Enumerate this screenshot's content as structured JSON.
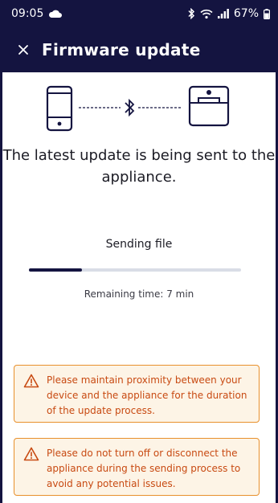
{
  "status": {
    "time": "09:05",
    "battery": "67%"
  },
  "appbar": {
    "title": "Firmware update"
  },
  "transfer": {
    "headline": "The latest update is being sent to the appliance.",
    "sending_label": "Sending file",
    "progress_fraction": 0.25,
    "remaining_text": "Remaining time: 7 min"
  },
  "warnings": [
    {
      "text": "Please maintain proximity between your device and the appliance for the duration of the update process."
    },
    {
      "text": "Please do not turn off or disconnect the appliance during the sending process to avoid any potential issues."
    }
  ],
  "colors": {
    "navy": "#141440",
    "warning_border": "#e8902c",
    "warning_bg": "#fdf4e6",
    "warning_text": "#c84a12"
  },
  "icons": [
    "cloud-icon",
    "bluetooth-icon",
    "wifi-icon",
    "signal-icon",
    "battery-icon",
    "close-icon",
    "phone-icon",
    "appliance-icon",
    "warning-icon"
  ]
}
